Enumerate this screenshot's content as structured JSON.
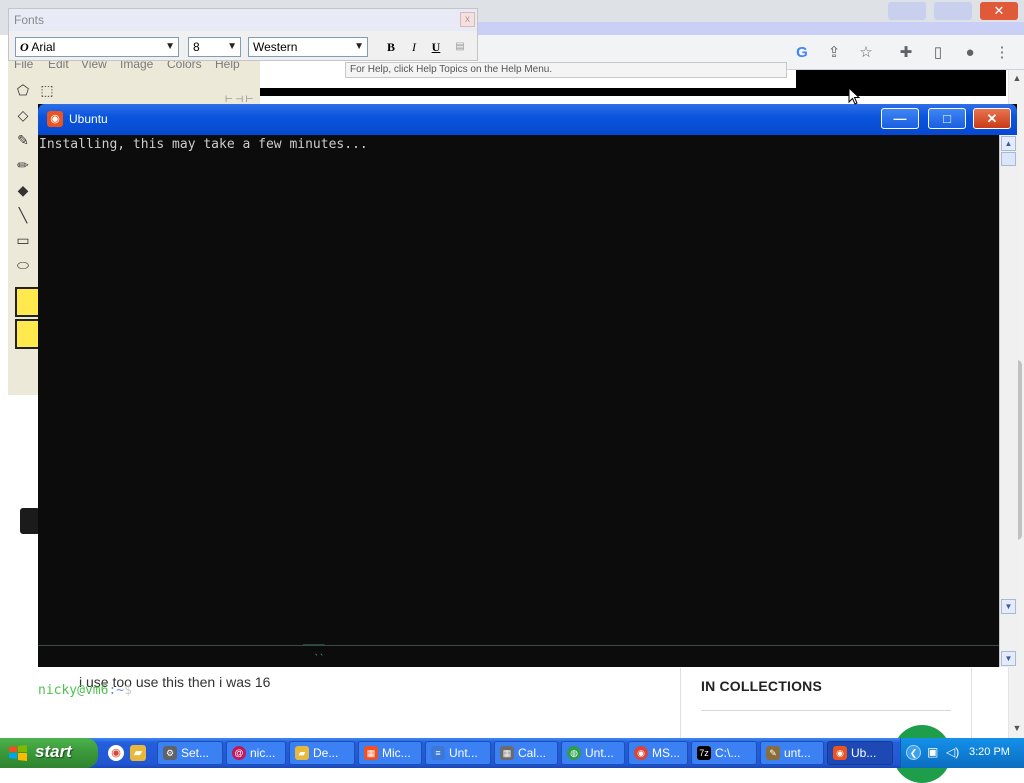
{
  "fonts_toolbar": {
    "title": "Fonts",
    "font_name": "Arial",
    "font_size": "8",
    "script": "Western",
    "bold": "B",
    "italic": "I",
    "underline": "U",
    "close": "x"
  },
  "paint": {
    "menu": [
      "File",
      "Edit",
      "View",
      "Image",
      "Colors",
      "Help"
    ]
  },
  "browser": {
    "help_tip": "For Help, click Help Topics on the Help Menu.",
    "comment": "i use too use this then i was 16",
    "collections_heading": "IN COLLECTIONS"
  },
  "ubuntu_window": {
    "title": "Ubuntu",
    "terminal_line": "Installing, this may take a few minutes...",
    "prompt_user": "nicky@vm6",
    "prompt_path": ":~",
    "prompt_symbol": "$",
    "min_glyph": "—",
    "max_glyph": "□",
    "close_glyph": "✕"
  },
  "taskbar": {
    "start_label": "start",
    "tasks": [
      {
        "label": "Set...",
        "icon_color": "#5f6368"
      },
      {
        "label": "nic...",
        "icon_color": "#c2185b"
      },
      {
        "label": "De...",
        "icon_color": "#e8b83a"
      },
      {
        "label": "Mic...",
        "icon_color": "#f25022"
      },
      {
        "label": "Unt...",
        "icon_color": "#3c78d8"
      },
      {
        "label": "Cal...",
        "icon_color": "#6b6b6b"
      },
      {
        "label": "Unt...",
        "icon_color": "#2e9e4a"
      },
      {
        "label": "MS...",
        "icon_color": "#db4437"
      },
      {
        "label": "C:\\...",
        "icon_color": "#000000"
      },
      {
        "label": "unt...",
        "icon_color": "#8a6d3b"
      },
      {
        "label": "Ub...",
        "icon_color": "#e95420"
      }
    ],
    "clock": "3:20 PM"
  },
  "colors": {
    "xp_blue": "#245edb",
    "terminal_bg": "#0c0c0c",
    "prompt_green": "#4ec24e",
    "ubuntu_orange": "#e95420"
  }
}
